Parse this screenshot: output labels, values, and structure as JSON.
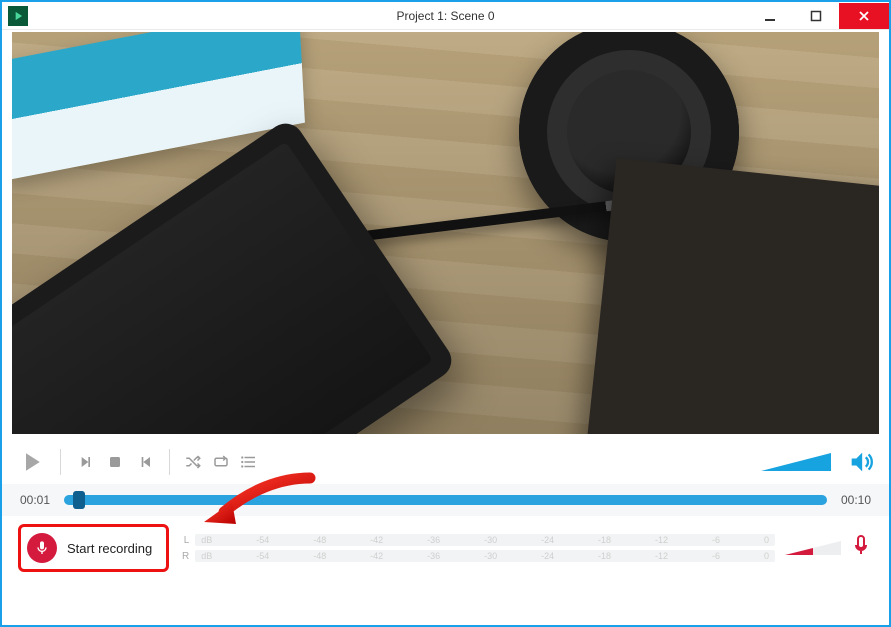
{
  "window": {
    "title": "Project 1: Scene 0"
  },
  "timeline": {
    "current": "00:01",
    "total": "00:10"
  },
  "record": {
    "label": "Start recording"
  },
  "meter": {
    "left_label": "L",
    "right_label": "R",
    "ticks": [
      "dB",
      "-54",
      "-48",
      "-42",
      "-36",
      "-30",
      "-24",
      "-18",
      "-12",
      "-6",
      "0"
    ]
  }
}
